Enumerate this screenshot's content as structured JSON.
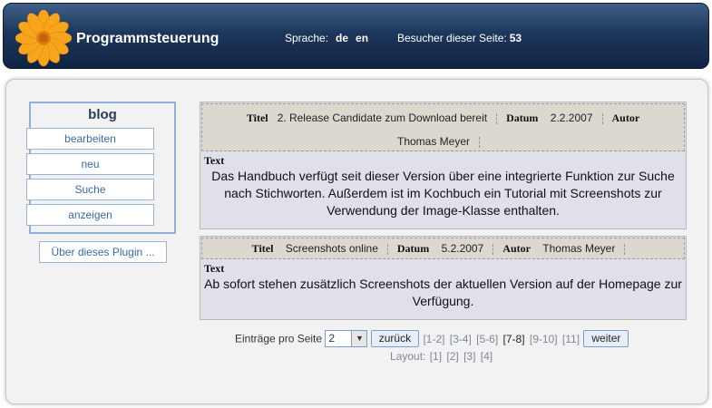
{
  "header": {
    "title": "Programmsteuerung",
    "lang_label": "Sprache:",
    "lang_de": "de",
    "lang_en": "en",
    "visitors_label": "Besucher dieser Seite:",
    "visitors_count": "53"
  },
  "sidebar": {
    "title": "blog",
    "items": [
      {
        "label": "bearbeiten"
      },
      {
        "label": "neu"
      },
      {
        "label": "Suche"
      },
      {
        "label": "anzeigen"
      }
    ],
    "plugin_button": "Über dieses Plugin ..."
  },
  "entries": [
    {
      "titel_label": "Titel",
      "titel": "2. Release Candidate zum Download bereit",
      "datum_label": "Datum",
      "datum": "2.2.2007",
      "autor_label": "Autor",
      "autor": "Thomas Meyer",
      "text_label": "Text",
      "text": "Das Handbuch verfügt seit dieser Version über eine integrierte Funktion zur Suche nach Stichworten. Außerdem ist im Kochbuch ein Tutorial mit Screenshots zur Verwendung der Image-Klasse enthalten."
    },
    {
      "titel_label": "Titel",
      "titel": "Screenshots online",
      "datum_label": "Datum",
      "datum": "5.2.2007",
      "autor_label": "Autor",
      "autor": "Thomas Meyer",
      "text_label": "Text",
      "text": "Ab sofort stehen zusätzlich Screenshots der aktuellen Version auf der Homepage zur Verfügung."
    }
  ],
  "pager": {
    "per_page_label": "Einträge pro Seite",
    "per_page_value": "2",
    "back": "zurück",
    "pages": [
      "[1-2]",
      "[3-4]",
      "[5-6]",
      "[7-8]",
      "[9-10]",
      "[11]"
    ],
    "next": "weiter",
    "layout_label": "Layout:",
    "layouts": [
      "[1]",
      "[2]",
      "[3]",
      "[4]"
    ]
  },
  "colors": {
    "header_bg": "#1d375c",
    "link": "#3a6aa8",
    "sidebar_border": "#8fb0d8"
  },
  "icons": {
    "logo": "orange-flower-icon",
    "select_arrow": "chevron-down-icon"
  }
}
